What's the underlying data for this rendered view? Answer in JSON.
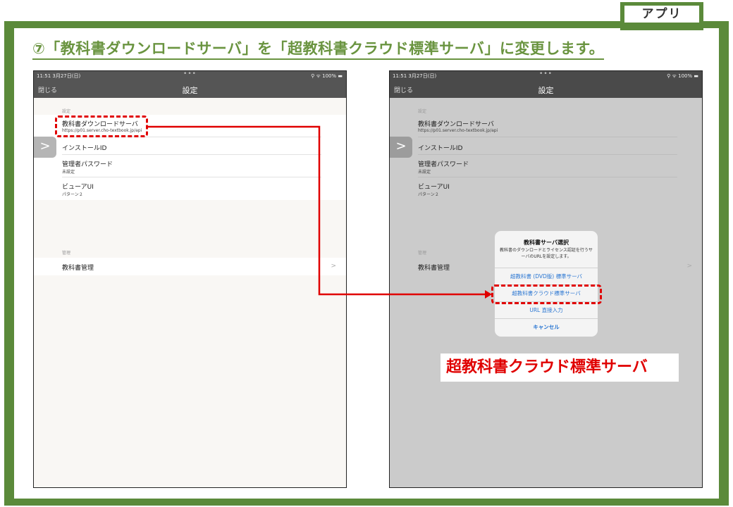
{
  "tab_label": "アプリ",
  "instruction": "⑦「教科書ダウンロードサーバ」を「超教科書クラウド標準サーバ」に変更します。",
  "status_bar": {
    "time": "11:51  3月27日(日)",
    "right": "⚲ ᯤ 100% ▬",
    "dots": "•••"
  },
  "nav": {
    "close": "閉じる",
    "title": "設定"
  },
  "settings": {
    "section_label": "設定",
    "rows": [
      {
        "title": "教科書ダウンロードサーバ",
        "sub": "https://p01.server.cho-textbook.jp/api"
      },
      {
        "title": "インストールID",
        "sub": ""
      },
      {
        "title": "管理者パスワード",
        "sub": "未設定"
      },
      {
        "title": "ビューアUI",
        "sub": "パターン２"
      }
    ]
  },
  "management": {
    "section_label": "管理",
    "row_title": "教科書管理",
    "chevron": ">"
  },
  "side_handle": ">",
  "dialog": {
    "title": "教科書サーバ選択",
    "message": "教科書のダウンロードとライセンス認証を行うサーバのURLを設定します。",
    "buttons": [
      "超教科書 (DVD版) 標準サーバ",
      "超教科書クラウド標準サーバ",
      "URL 直接入力",
      "キャンセル"
    ]
  },
  "caption": "超教科書クラウド標準サーバ",
  "colors": {
    "frame_green": "#5b8a3a",
    "instruction_green": "#6a9440",
    "highlight_red": "#e00000",
    "ios_blue": "#2a76d2"
  }
}
